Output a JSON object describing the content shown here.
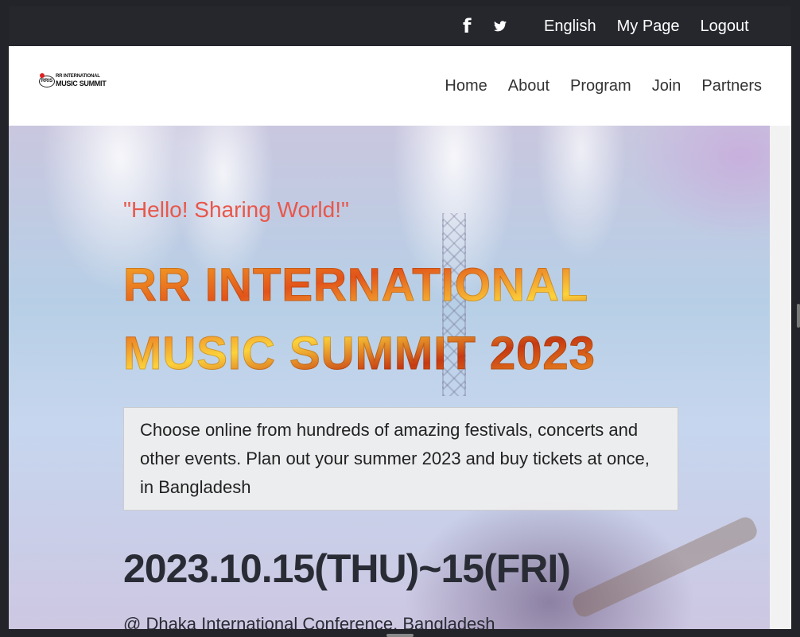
{
  "topbar": {
    "links": [
      "English",
      "My Page",
      "Logout"
    ]
  },
  "nav": {
    "logo": {
      "badge": "RRIS",
      "line1": "RR INTERNATIONAL",
      "line2": "MUSIC SUMMIT"
    },
    "items": [
      "Home",
      "About",
      "Program",
      "Join",
      "Partners"
    ]
  },
  "hero": {
    "tagline": "\"Hello! Sharing World!\"",
    "title_line1": "RR INTERNATIONAL",
    "title_line2": "MUSIC SUMMIT 2023",
    "description": "Choose online from hundreds of amazing festivals, concerts and other events. Plan out your summer 2023 and buy tickets at once, in Bangladesh",
    "date": "2023.10.15(THU)~15(FRI)",
    "venue": "@ Dhaka International Conference, Bangladesh"
  },
  "colors": {
    "tagline": "#e8574b",
    "topbar": "#25272d",
    "date_text": "#2a2c35"
  }
}
